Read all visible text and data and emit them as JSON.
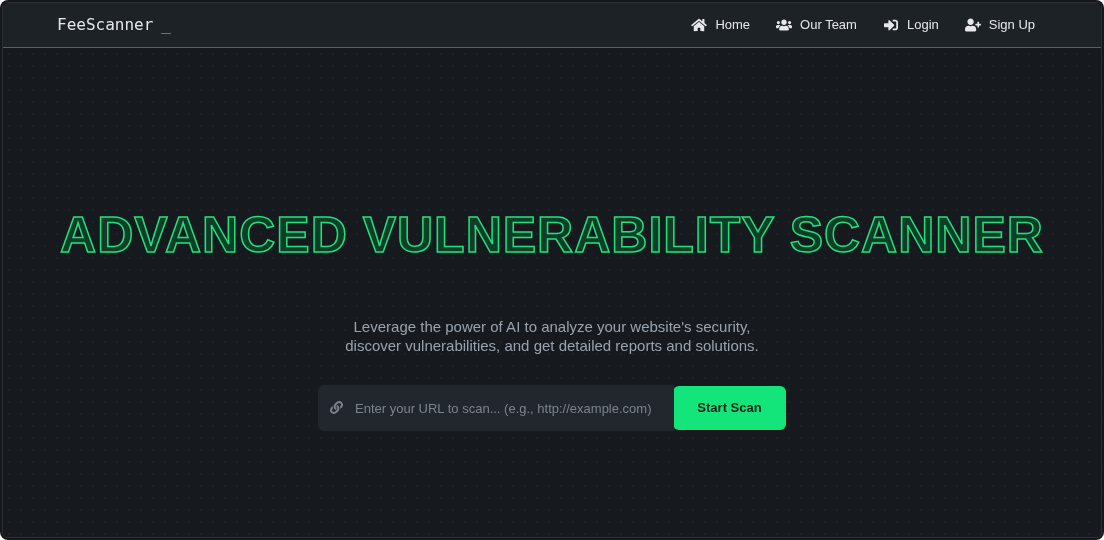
{
  "navbar": {
    "brand": "FeeScanner",
    "cursor": "_",
    "links": [
      {
        "kind": "home",
        "label": "Home"
      },
      {
        "kind": "team",
        "label": "Our Team"
      },
      {
        "kind": "login",
        "label": "Login"
      },
      {
        "kind": "signup",
        "label": "Sign Up"
      }
    ]
  },
  "hero": {
    "title": "ADVANCED VULNERABILITY SCANNER",
    "subtitle": "Leverage the power of AI to analyze your website's security, discover vulnerabilities, and get detailed reports and solutions.",
    "search": {
      "placeholder": "Enter your URL to scan... (e.g., http://example.com)",
      "button": "Start Scan"
    }
  }
}
